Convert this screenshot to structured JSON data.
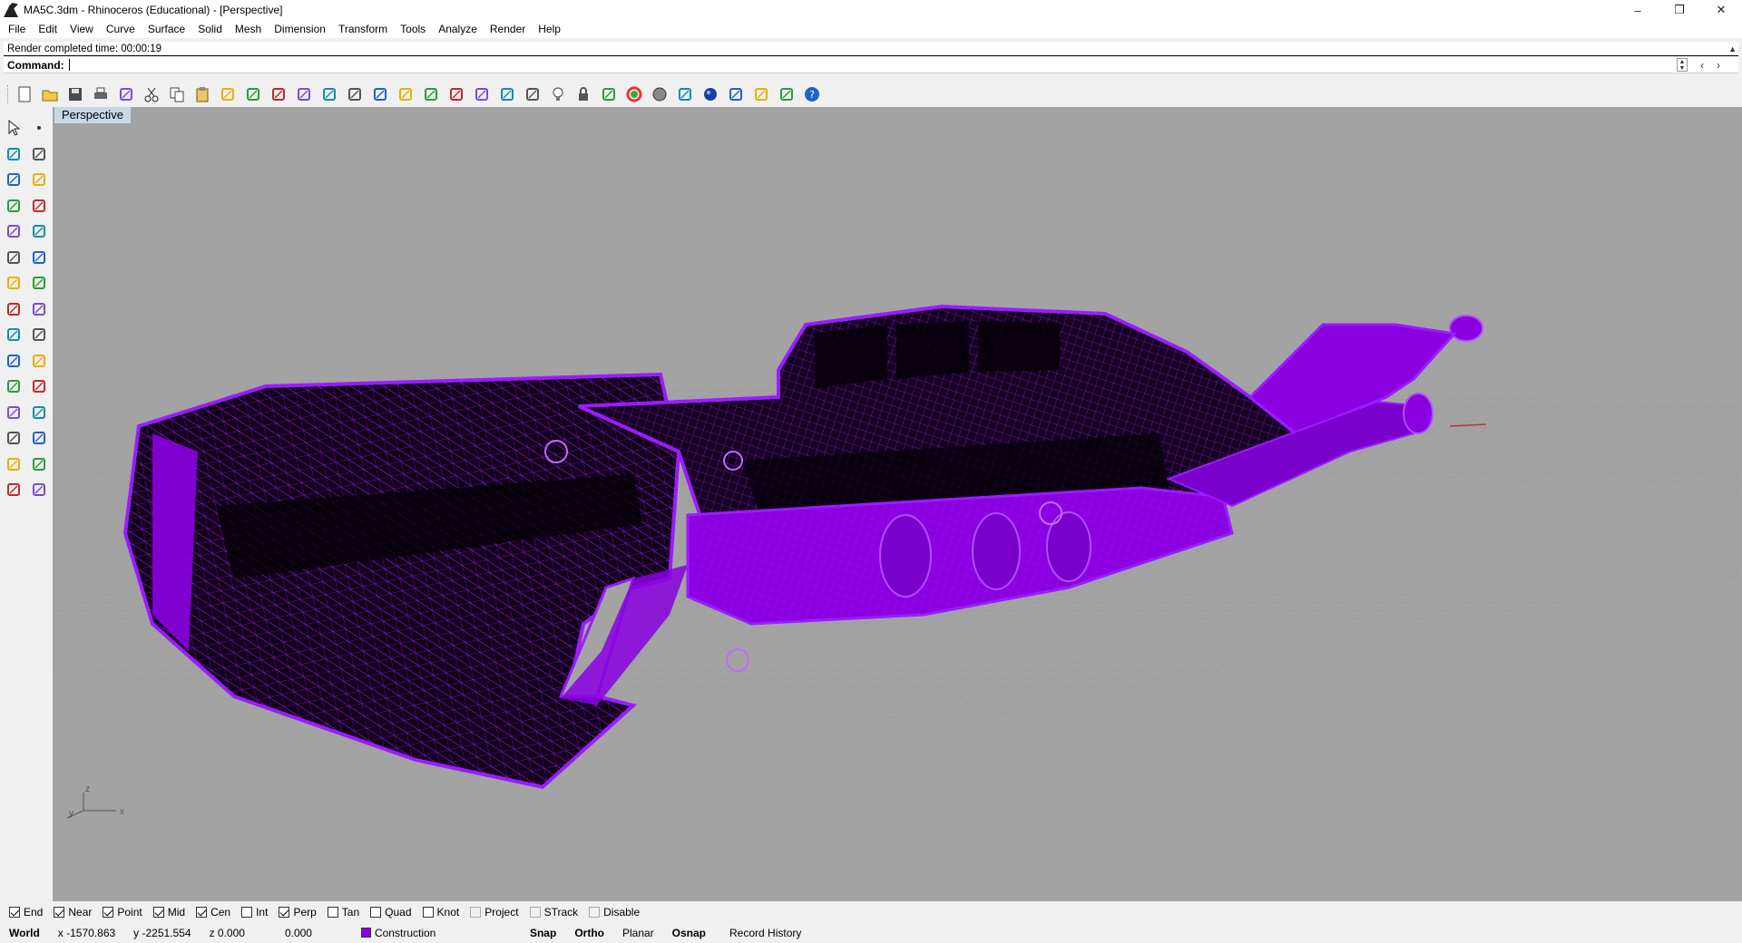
{
  "window": {
    "title": "MA5C.3dm - Rhinoceros (Educational) - [Perspective]",
    "controls": [
      "–",
      "❒",
      "✕"
    ]
  },
  "menu": [
    "File",
    "Edit",
    "View",
    "Curve",
    "Surface",
    "Solid",
    "Mesh",
    "Dimension",
    "Transform",
    "Tools",
    "Analyze",
    "Render",
    "Help"
  ],
  "command": {
    "history": "Render completed time: 00:00:19",
    "label": "Command:",
    "value": ""
  },
  "toolbar": {
    "icons": [
      "new-icon",
      "open-icon",
      "save-icon",
      "print-icon",
      "import-icon",
      "cut-icon",
      "copy-icon",
      "paste-icon",
      "undo-icon",
      "pan-icon",
      "rotate-view-icon",
      "zoom-dynamic-icon",
      "zoom-window-icon",
      "zoom-extents-icon",
      "zoom-selected-icon",
      "rotate-icon",
      "four-viewports-icon",
      "car-icon",
      "grid-icon",
      "named-view-icon",
      "lights-icon",
      "lightbulb-icon",
      "lock-icon",
      "layer-icon",
      "color-wheel-icon",
      "shaded-sphere-icon",
      "rendered-icon",
      "sphere-render-icon",
      "flag-icon",
      "gear-tools-icon",
      "options-icon",
      "help-icon"
    ]
  },
  "left_toolbar": {
    "icons": [
      "select-icon",
      "point-icon",
      "polyline-icon",
      "curve-icon",
      "circle-icon",
      "arc-icon",
      "polygon-icon",
      "rectangle-icon",
      "ellipse-icon",
      "fillet-icon",
      "surface-icon",
      "sweep-icon",
      "box-icon",
      "boolean-icon",
      "cylinder-icon",
      "extrude-icon",
      "explode-icon",
      "trim-icon",
      "move-icon",
      "align-icon",
      "mesh-icon",
      "group-icon",
      "rotate-tool-icon",
      "transform-icon",
      "text-icon",
      "scale-icon",
      "array-icon",
      "dimension-icon",
      "render-tool-icon",
      "hatch-icon"
    ]
  },
  "viewport": {
    "label": "Perspective",
    "axes": {
      "z": "z",
      "y": "y",
      "x": "x"
    },
    "model_color": "#8a00e0"
  },
  "osnaps": [
    {
      "label": "End",
      "checked": true
    },
    {
      "label": "Near",
      "checked": true
    },
    {
      "label": "Point",
      "checked": true
    },
    {
      "label": "Mid",
      "checked": true
    },
    {
      "label": "Cen",
      "checked": true
    },
    {
      "label": "Int",
      "checked": false
    },
    {
      "label": "Perp",
      "checked": true
    },
    {
      "label": "Tan",
      "checked": false
    },
    {
      "label": "Quad",
      "checked": false
    },
    {
      "label": "Knot",
      "checked": false
    },
    {
      "label": "Project",
      "checked": false,
      "style": "disabled"
    },
    {
      "label": "STrack",
      "checked": false,
      "style": "disabled"
    },
    {
      "label": "Disable",
      "checked": false,
      "style": "disabled"
    }
  ],
  "status": {
    "cplane": "World",
    "x": "x -1570.863",
    "y": "y -2251.554",
    "z": "z 0.000",
    "distance": "0.000",
    "layer": "Construction",
    "layer_color": "#8a00e0",
    "toggles": [
      "Snap",
      "Ortho",
      "Planar",
      "Osnap"
    ],
    "record_history": "Record History"
  }
}
